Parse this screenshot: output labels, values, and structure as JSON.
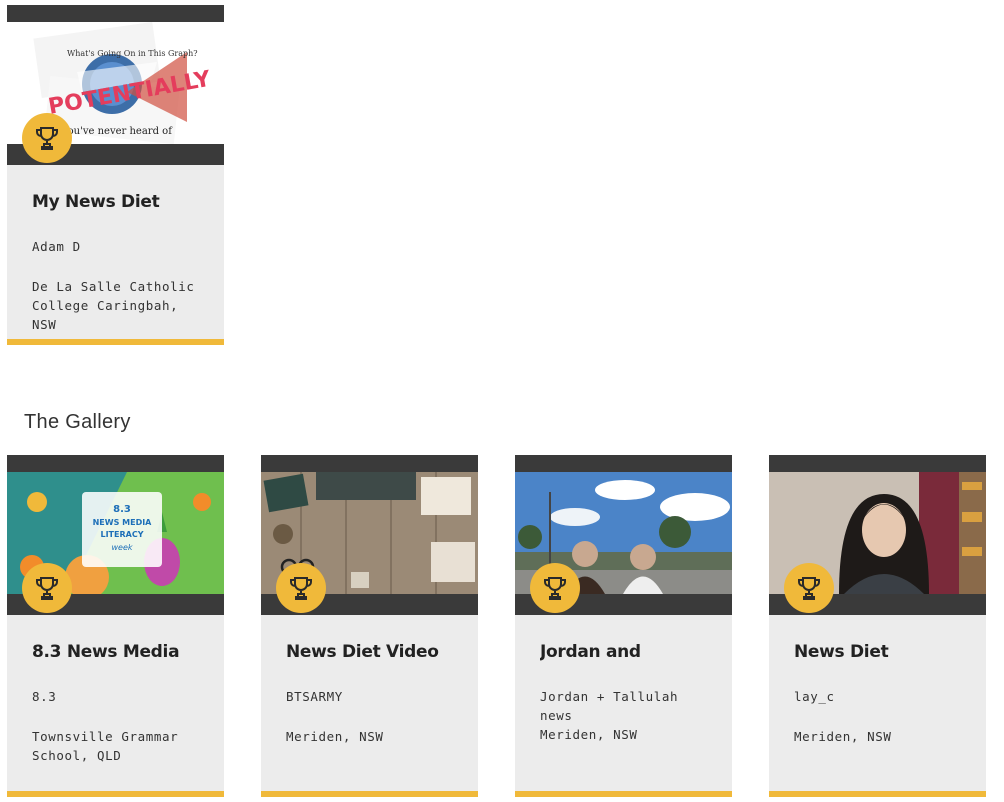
{
  "featured": {
    "title": "My News Diet",
    "author": "Adam D",
    "school": "De La Salle Catholic College Caringbah, NSW",
    "thumb_text": [
      "POTENTIALLY",
      "What's Going On in This Graph?",
      "you've never heard of"
    ]
  },
  "gallery": {
    "heading": "The Gallery",
    "cards": [
      {
        "title": "8.3 News Media",
        "author": "8.3",
        "school": "Townsville Grammar School, QLD",
        "thumb_text": [
          "8.3",
          "NEWS MEDIA",
          "LITERACY",
          "week"
        ]
      },
      {
        "title": "News Diet Video",
        "author": "BTSARMY",
        "school": "Meriden, NSW"
      },
      {
        "title": "Jordan and",
        "author": "Jordan + Tallulah news",
        "school": "Meriden, NSW"
      },
      {
        "title": "News Diet",
        "author": "lay_c",
        "school": "Meriden, NSW"
      }
    ]
  },
  "colors": {
    "accent": "#f0b93a",
    "bar": "#3a3a3a",
    "card": "#ececec"
  },
  "icons": {
    "award": "trophy-icon"
  }
}
